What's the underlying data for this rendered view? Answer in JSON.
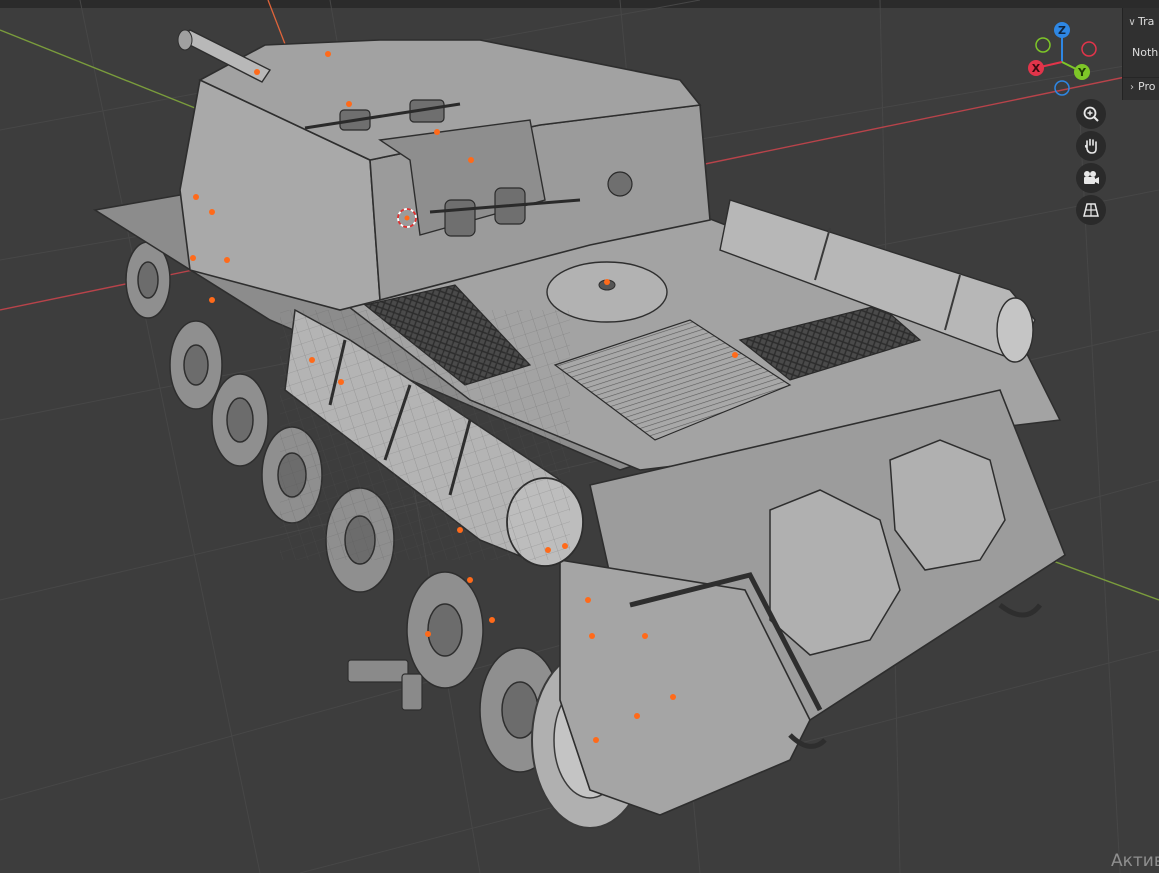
{
  "sidebar": {
    "transform_label": "Tra",
    "nothing_label": "Nothi",
    "properties_label": "Pro"
  },
  "gizmo": {
    "x_label": "X",
    "y_label": "Y",
    "z_label": "Z",
    "x_color": "#e2344a",
    "y_color": "#7ec628",
    "z_color": "#2e87e4"
  },
  "nav": {
    "zoom_icon": "zoom-in-icon",
    "pan_icon": "hand-icon",
    "camera_icon": "camera-icon",
    "ortho_icon": "grid-perspective-icon"
  },
  "watermark": {
    "text": "Актив"
  },
  "colors": {
    "background": "#3d3d3d",
    "mesh": "#9a9a9a",
    "x_axis_line": "#b8434a",
    "y_axis_line": "#7a9c3c",
    "origin_dot": "#ff6a1a"
  }
}
